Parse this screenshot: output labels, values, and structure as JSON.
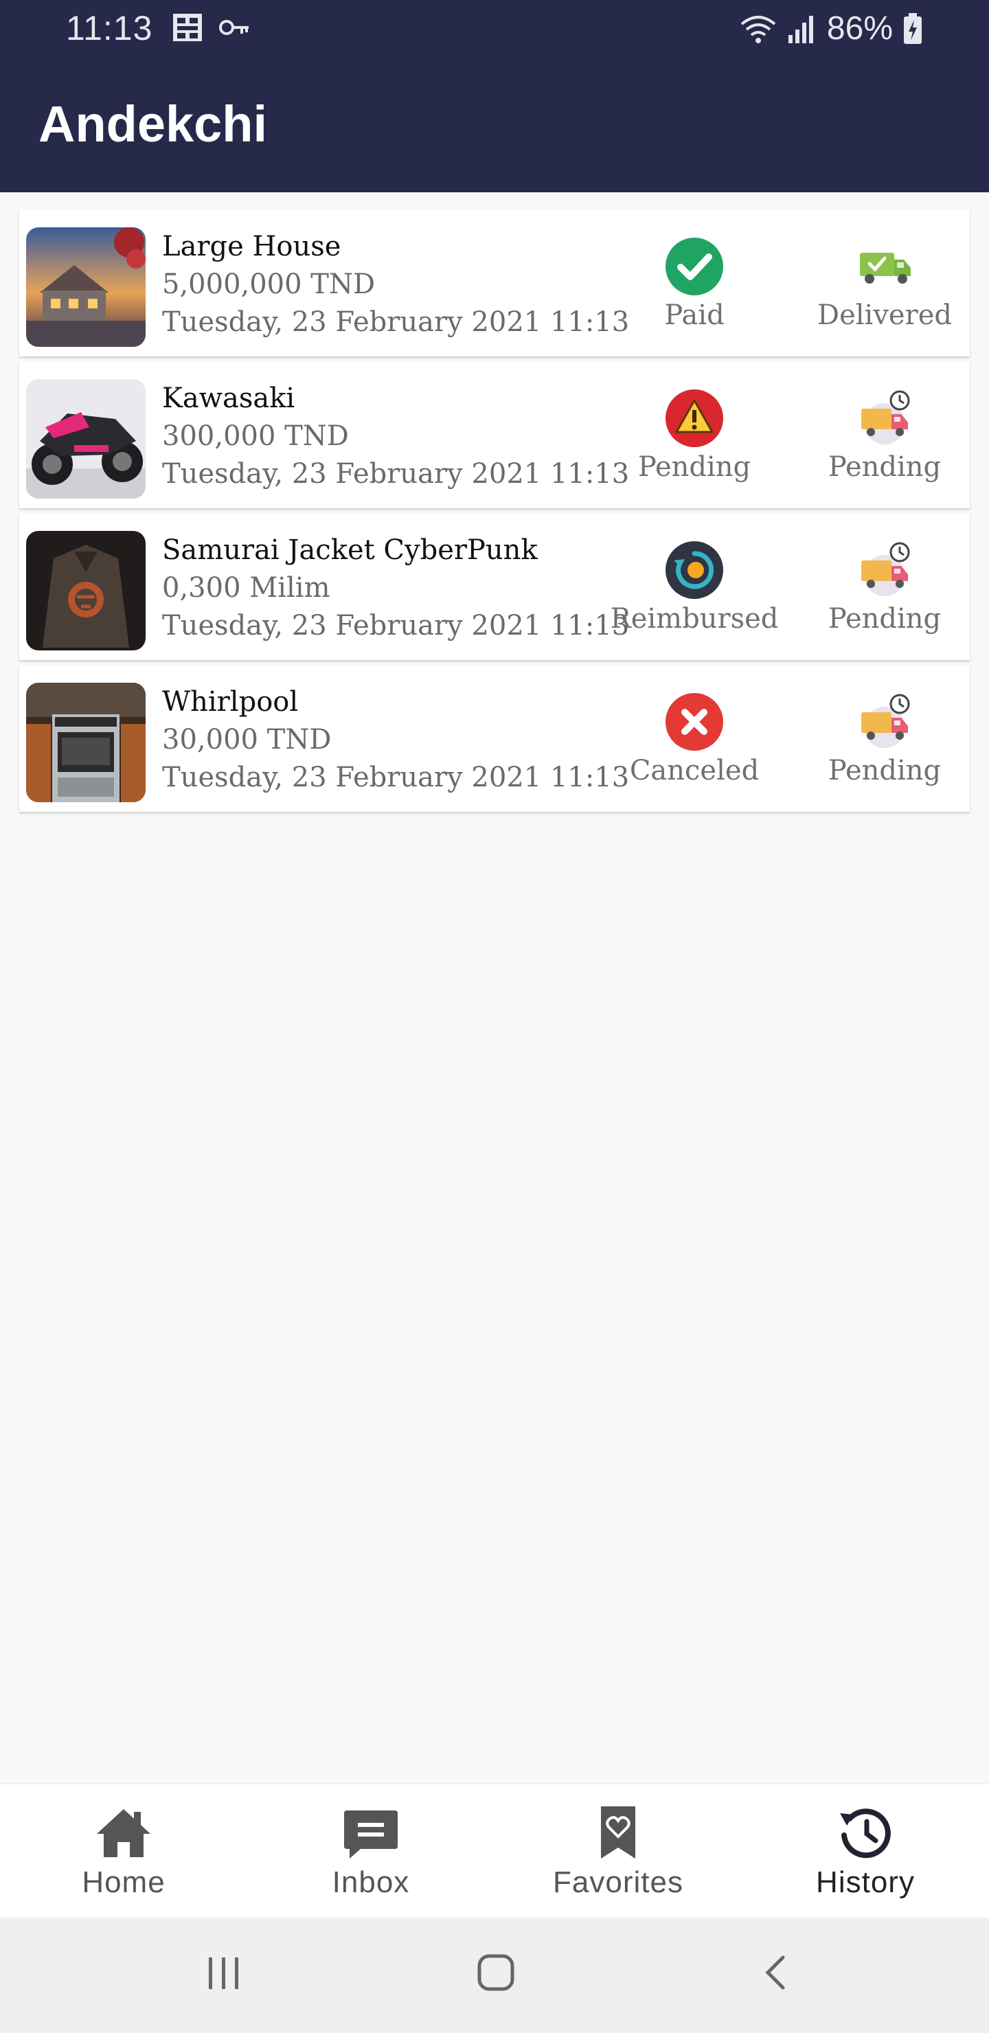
{
  "status_bar": {
    "time": "11:13",
    "battery": "86%",
    "icons": [
      "grid-icon",
      "key-icon",
      "wifi-icon",
      "signal-icon",
      "battery-icon"
    ]
  },
  "app_bar": {
    "title": "Andekchi"
  },
  "orders": [
    {
      "name": "Large House",
      "price": "5,000,000 TND",
      "date": "Tuesday, 23 February 2021 11:13",
      "image": "house-photo",
      "payment": {
        "label": "Paid",
        "icon": "paid-check-icon",
        "color": "#1fa463"
      },
      "shipping": {
        "label": "Delivered",
        "icon": "delivered-truck-icon"
      }
    },
    {
      "name": "Kawasaki",
      "price": "300,000 TND",
      "date": "Tuesday, 23 February 2021 11:13",
      "image": "motorcycle-photo",
      "payment": {
        "label": "Pending",
        "icon": "pending-warning-icon",
        "color": "#d9272e"
      },
      "shipping": {
        "label": "Pending",
        "icon": "pending-truck-icon"
      }
    },
    {
      "name": "Samurai Jacket CyberPunk",
      "price": "0,300 Milim",
      "date": "Tuesday, 23 February 2021 11:13",
      "image": "jacket-photo",
      "payment": {
        "label": "Reimbursed",
        "icon": "reimbursed-icon",
        "color": "#2f3542"
      },
      "shipping": {
        "label": "Pending",
        "icon": "pending-truck-icon"
      }
    },
    {
      "name": "Whirlpool",
      "price": "30,000 TND",
      "date": "Tuesday, 23 February 2021 11:13",
      "image": "oven-photo",
      "payment": {
        "label": "Canceled",
        "icon": "canceled-x-icon",
        "color": "#e53935"
      },
      "shipping": {
        "label": "Pending",
        "icon": "pending-truck-icon"
      }
    }
  ],
  "bottom_nav": {
    "items": [
      {
        "label": "Home",
        "icon": "home-icon",
        "active": false
      },
      {
        "label": "Inbox",
        "icon": "inbox-icon",
        "active": false
      },
      {
        "label": "Favorites",
        "icon": "favorites-icon",
        "active": false
      },
      {
        "label": "History",
        "icon": "history-icon",
        "active": true
      }
    ]
  },
  "system_nav": [
    "recents-icon",
    "home-circle-icon",
    "back-icon"
  ],
  "colors": {
    "app_bar": "#27294a",
    "background": "#f8f8f8"
  }
}
